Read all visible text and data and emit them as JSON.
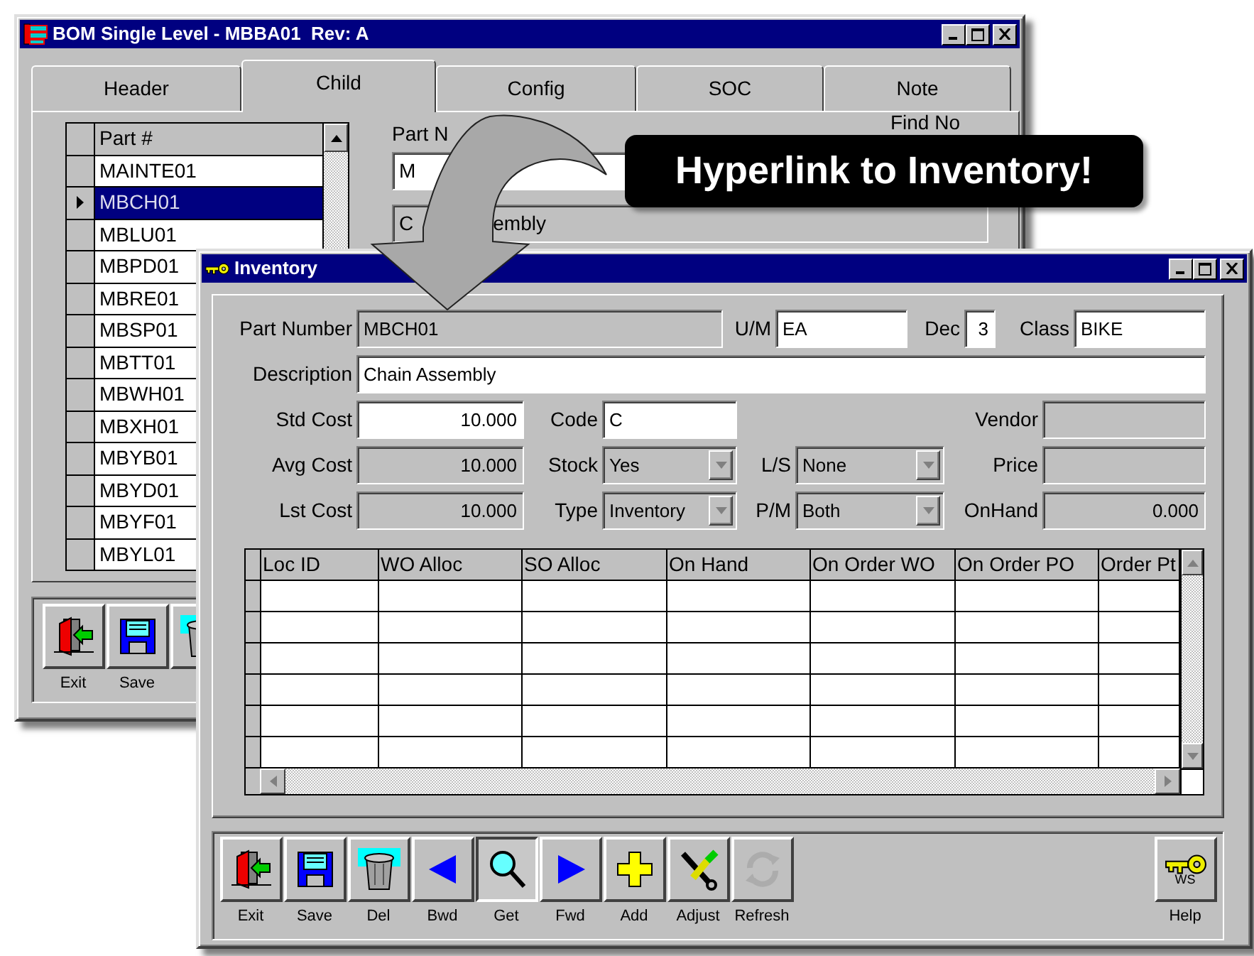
{
  "back_window": {
    "title": "BOM Single Level - MBBA01  Rev: A",
    "tabs": [
      {
        "label": "Header",
        "selected": false
      },
      {
        "label": "Child",
        "selected": true
      },
      {
        "label": "Config",
        "selected": false
      },
      {
        "label": "SOC",
        "selected": false
      },
      {
        "label": "Note",
        "selected": false
      }
    ],
    "parts_list": {
      "column": "Part #",
      "rows": [
        {
          "part": "MAINTE01",
          "selected": false
        },
        {
          "part": "MBCH01",
          "selected": true
        },
        {
          "part": "MBLU01",
          "selected": false
        },
        {
          "part": "MBPD01",
          "selected": false
        },
        {
          "part": "MBRE01",
          "selected": false
        },
        {
          "part": "MBSP01",
          "selected": false
        },
        {
          "part": "MBTT01",
          "selected": false
        },
        {
          "part": "MBWH01",
          "selected": false
        },
        {
          "part": "MBXH01",
          "selected": false
        },
        {
          "part": "MBYB01",
          "selected": false
        },
        {
          "part": "MBYD01",
          "selected": false
        },
        {
          "part": "MBYF01",
          "selected": false
        },
        {
          "part": "MBYL01",
          "selected": false
        }
      ]
    },
    "detail": {
      "part_label": "Part N",
      "part_value": "M",
      "find_label": "Find No",
      "description_parts": [
        "C",
        "embly"
      ]
    },
    "toolbar": [
      {
        "label": "Exit"
      },
      {
        "label": "Save"
      }
    ]
  },
  "callout": {
    "text": "Hyperlink to Inventory!"
  },
  "inventory_window": {
    "title": "Inventory",
    "form_rows": [
      {
        "fields": [
          {
            "label": "Part Number",
            "value": "MBCH01",
            "kind": "text",
            "readonly": true
          },
          {
            "label": "U/M",
            "value": "EA",
            "kind": "text",
            "readonly": false
          },
          {
            "label": "Dec",
            "value": "3",
            "kind": "number",
            "readonly": false
          },
          {
            "label": "Class",
            "value": "BIKE",
            "kind": "text",
            "readonly": false
          }
        ]
      },
      {
        "fields": [
          {
            "label": "Description",
            "value": "Chain Assembly",
            "kind": "text",
            "readonly": false
          }
        ]
      },
      {
        "fields": [
          {
            "label": "Std Cost",
            "value": "10.000",
            "kind": "number",
            "readonly": false
          },
          {
            "label": "Code",
            "value": "C",
            "kind": "text",
            "readonly": false
          },
          {
            "label": "Vendor",
            "kind": "text",
            "readonly": true
          }
        ]
      },
      {
        "fields": [
          {
            "label": "Avg Cost",
            "value": "10.000",
            "kind": "number",
            "readonly": true
          },
          {
            "label": "Stock",
            "value": "Yes",
            "kind": "combo",
            "readonly": true
          },
          {
            "label": "L/S",
            "value": "None",
            "kind": "combo",
            "readonly": true
          },
          {
            "label": "Price",
            "kind": "text",
            "readonly": true
          }
        ]
      },
      {
        "fields": [
          {
            "label": "Lst Cost",
            "value": "10.000",
            "kind": "number",
            "readonly": true
          },
          {
            "label": "Type",
            "value": "Inventory",
            "kind": "combo",
            "readonly": true
          },
          {
            "label": "P/M",
            "value": "Both",
            "kind": "combo",
            "readonly": true
          },
          {
            "label": "OnHand",
            "value": "0.000",
            "kind": "number",
            "readonly": true
          }
        ]
      }
    ],
    "grid": {
      "columns": [
        "Loc ID",
        "WO Alloc",
        "SO Alloc",
        "On Hand",
        "On Order WO",
        "On Order PO",
        "Order Pt"
      ]
    },
    "toolbar": [
      {
        "label": "Exit",
        "selected": false,
        "disabled": false
      },
      {
        "label": "Save",
        "selected": false,
        "disabled": false
      },
      {
        "label": "Del",
        "selected": false,
        "disabled": false
      },
      {
        "label": "Bwd",
        "selected": false,
        "disabled": false
      },
      {
        "label": "Get",
        "selected": true,
        "disabled": false
      },
      {
        "label": "Fwd",
        "selected": false,
        "disabled": false
      },
      {
        "label": "Add",
        "selected": false,
        "disabled": false
      },
      {
        "label": "Adjust",
        "selected": false,
        "disabled": false
      },
      {
        "label": "Refresh",
        "selected": false,
        "disabled": true
      }
    ],
    "help": {
      "label": "Help",
      "caption": "WS"
    }
  }
}
